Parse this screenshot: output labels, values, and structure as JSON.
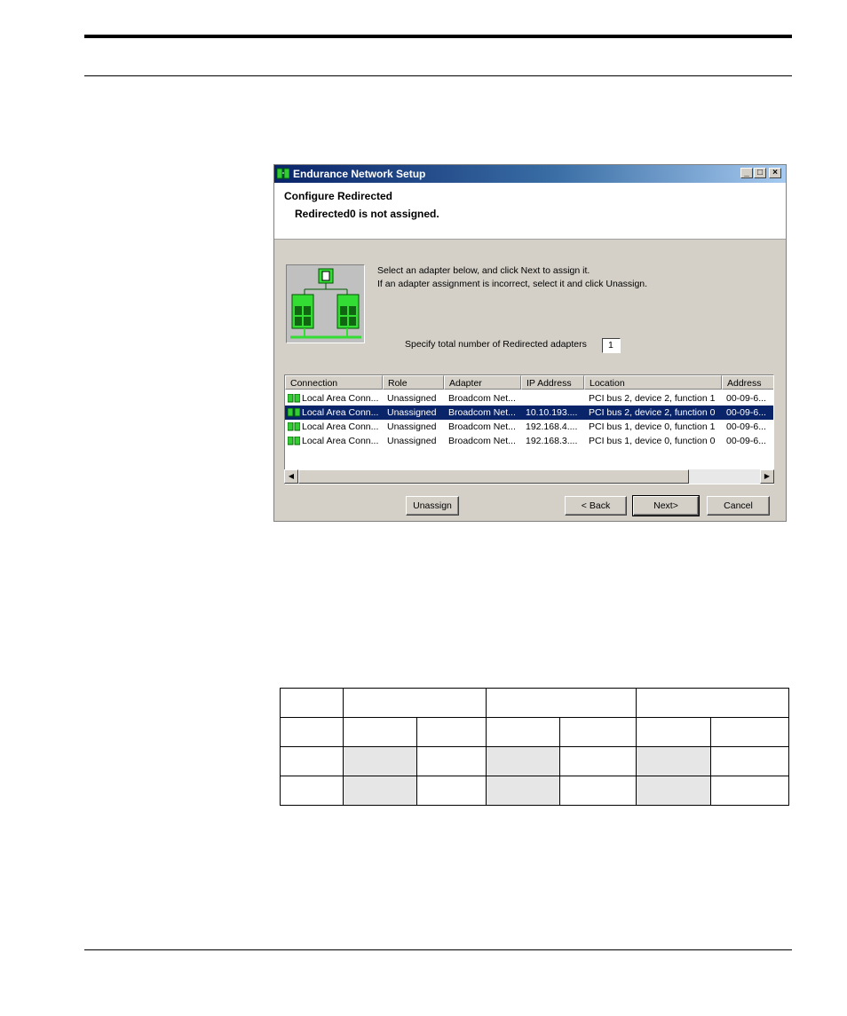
{
  "window": {
    "title": "Endurance Network Setup",
    "minimize_glyph": "_",
    "maximize_glyph": "□",
    "close_glyph": "×"
  },
  "header": {
    "title": "Configure Redirected",
    "subtitle": "Redirected0 is not assigned."
  },
  "instructions": {
    "line1": "Select an adapter below, and click Next to assign it.",
    "line2": "If an adapter assignment is incorrect, select it and click Unassign."
  },
  "count": {
    "label": "Specify total number of Redirected adapters",
    "value": "1"
  },
  "listview": {
    "columns": [
      "Connection",
      "Role",
      "Adapter",
      "IP Address",
      "Location",
      "Address"
    ],
    "rows": [
      {
        "connection": "Local Area Conn...",
        "role": "Unassigned",
        "adapter": "Broadcom Net...",
        "ip": "",
        "location": "PCI bus 2, device 2, function 1",
        "address": "00-09-6..."
      },
      {
        "connection": "Local Area Conn...",
        "role": "Unassigned",
        "adapter": "Broadcom Net...",
        "ip": "10.10.193....",
        "location": "PCI bus 2, device 2, function 0",
        "address": "00-09-6..."
      },
      {
        "connection": "Local Area Conn...",
        "role": "Unassigned",
        "adapter": "Broadcom Net...",
        "ip": "192.168.4....",
        "location": "PCI bus 1, device 0, function 1",
        "address": "00-09-6..."
      },
      {
        "connection": "Local Area Conn...",
        "role": "Unassigned",
        "adapter": "Broadcom Net...",
        "ip": "192.168.3....",
        "location": "PCI bus 1, device 0, function 0",
        "address": "00-09-6..."
      }
    ],
    "selected_row_index": 1
  },
  "scrollbar": {
    "left_arrow": "◀",
    "right_arrow": "▶"
  },
  "buttons": {
    "unassign": "Unassign",
    "back": "< Back",
    "next": "Next>",
    "cancel": "Cancel"
  },
  "colors": {
    "selection": "#0a246a",
    "titlebar": "#0a246a",
    "dialog_face": "#d4d0c8",
    "illustration_green": "#33dd33",
    "table_shade": "#e6e6e6"
  },
  "icons": {
    "title": "network-icon",
    "row": "network-adapter-icon",
    "illustration": "network-topology-icon"
  }
}
